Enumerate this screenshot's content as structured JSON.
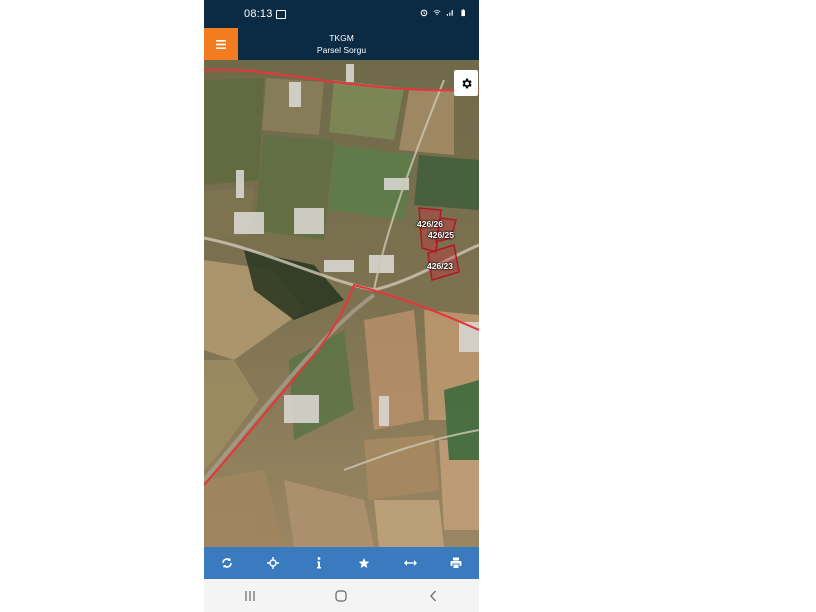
{
  "status": {
    "time": "08:13"
  },
  "appbar": {
    "title": "TKGM",
    "subtitle": "Parsel Sorgu"
  },
  "map": {
    "parcels": [
      {
        "label": "426/26"
      },
      {
        "label": "426/25"
      },
      {
        "label": "426/23"
      }
    ]
  },
  "toolbar": {
    "items": [
      {
        "icon": "refresh-icon"
      },
      {
        "icon": "locate-icon"
      },
      {
        "icon": "info-icon"
      },
      {
        "icon": "star-icon"
      },
      {
        "icon": "measure-icon"
      },
      {
        "icon": "print-icon"
      }
    ]
  },
  "colors": {
    "appbar": "#0b2a44",
    "menu_button": "#f47c20",
    "toolbar": "#3a7bc0",
    "boundary": "#e8343a",
    "parcel_outline": "#b01828"
  }
}
